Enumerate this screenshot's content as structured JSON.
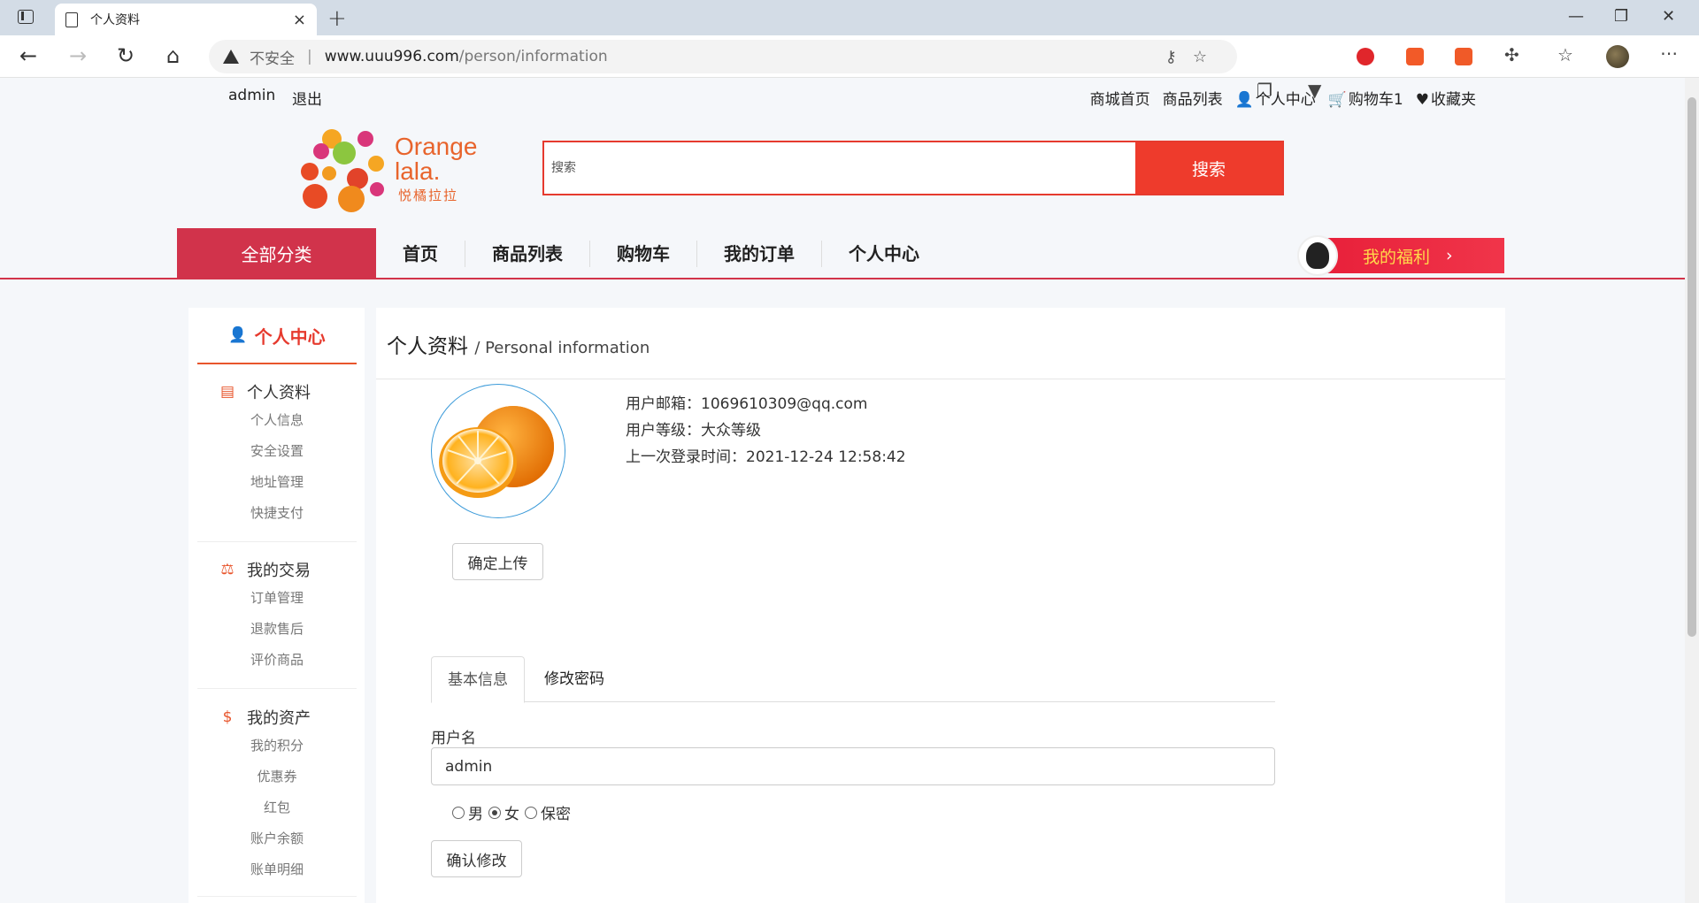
{
  "browser": {
    "tab_title": "个人资料",
    "tab_close": "×",
    "new_tab": "+",
    "url_security": "不安全",
    "url_host": "www.uuu996.com",
    "url_path": "/person/information",
    "win_min": "—",
    "win_max": "❐",
    "win_close": "✕"
  },
  "topbar": {
    "user": "admin",
    "logout": "退出",
    "links": [
      "商城首页",
      "商品列表",
      "个人中心",
      "购物车1",
      "收藏夹"
    ]
  },
  "logo": {
    "text_line1": "Orange",
    "text_line2": "lala.",
    "sub": "悦橘拉拉"
  },
  "search": {
    "placeholder": "搜索",
    "button": "搜索"
  },
  "nav": {
    "all_categories": "全部分类",
    "items": [
      "首页",
      "商品列表",
      "购物车",
      "我的订单",
      "个人中心"
    ],
    "welfare": "我的福利",
    "welfare_arrow": "›"
  },
  "sidebar": {
    "title": "个人中心",
    "groups": [
      {
        "title": "个人资料",
        "icon": "id-card-icon",
        "items": [
          "个人信息",
          "安全设置",
          "地址管理",
          "快捷支付"
        ]
      },
      {
        "title": "我的交易",
        "icon": "scale-icon",
        "items": [
          "订单管理",
          "退款售后",
          "评价商品"
        ]
      },
      {
        "title": "我的资产",
        "icon": "dollar-icon",
        "items": [
          "我的积分",
          "优惠券",
          "红包",
          "账户余额",
          "账单明细"
        ]
      }
    ]
  },
  "main": {
    "title": "个人资料",
    "title_en": "/ Personal information",
    "upload_button": "确定上传",
    "email_label": "用户邮箱：",
    "email": "1069610309@qq.com",
    "level_label": "用户等级：",
    "level": "大众等级",
    "last_login_label": "上一次登录时间：",
    "last_login": "2021-12-24 12:58:42",
    "tabs": [
      "基本信息",
      "修改密码"
    ],
    "username_label": "用户名",
    "username_value": "admin",
    "gender_options": [
      "男",
      "女",
      "保密"
    ],
    "gender_selected": "女",
    "confirm_button": "确认修改"
  },
  "colors": {
    "accent_red": "#ee3b2c",
    "nav_red": "#d1334b",
    "orange": "#e8642c",
    "welfare_text": "#ffd84a"
  }
}
